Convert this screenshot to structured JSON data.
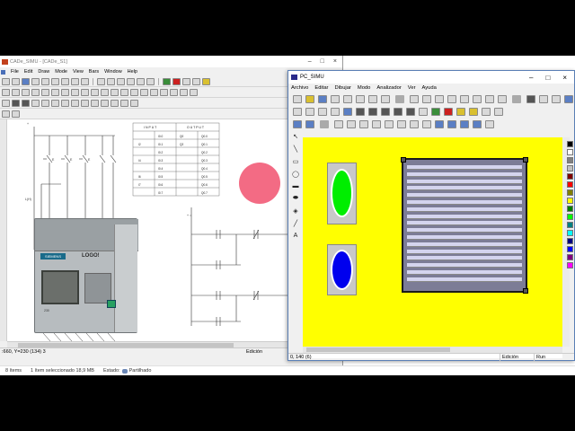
{
  "cade_simu": {
    "title": "CADe_SIMU - [CADe_S1]",
    "menu": [
      "File",
      "Edit",
      "Draw",
      "Mode",
      "View",
      "Bars",
      "Window",
      "Help"
    ],
    "status_coords": ":660, Y=230 (134) 3",
    "status_mode": "Edición",
    "io_table": {
      "header_input": "I N P U T",
      "header_output": "O U T P U T",
      "rows": [
        [
          "",
          "I0.0",
          "Q0",
          "Q0.0"
        ],
        [
          "I2",
          "I0.1",
          "Q2",
          "Q0.1"
        ],
        [
          "",
          "I0.2",
          "",
          "Q0.2"
        ],
        [
          "I4",
          "I0.3",
          "",
          "Q0.3"
        ],
        [
          "",
          "I0.4",
          "",
          "Q0.4"
        ],
        [
          "I6",
          "I0.5",
          "",
          "Q0.5"
        ],
        [
          "I7",
          "I0.6",
          "",
          "Q0.6"
        ],
        [
          "",
          "I0.7",
          "",
          "Q0.7"
        ]
      ]
    },
    "plc": {
      "brand": "SIEMENS",
      "model": "LOGO!",
      "small_label": "230"
    }
  },
  "explorer": {
    "items": "8 ítems",
    "selected": "1 ítem seleccionado 18,9 MB",
    "state_label": "Estado:",
    "state_value": "Partilhado"
  },
  "pc_simu": {
    "title": "PC_SIMU",
    "menu": [
      "Archivo",
      "Editar",
      "Dibujar",
      "Modo",
      "Analizador",
      "Ver",
      "Ayuda"
    ],
    "status_coords": "0, 140 (6)",
    "status_mode": "Edición",
    "status_run": "Run",
    "palette_colors": [
      "#000000",
      "#ffffff",
      "#808080",
      "#c0c0c0",
      "#800000",
      "#ff0000",
      "#808000",
      "#ffff00",
      "#008000",
      "#00ff00",
      "#008080",
      "#00ffff",
      "#000080",
      "#0000ff",
      "#800080",
      "#ff00ff"
    ],
    "pilot_green": "#00ee00",
    "pilot_blue": "#0000ee",
    "canvas_color": "#ffff00"
  }
}
